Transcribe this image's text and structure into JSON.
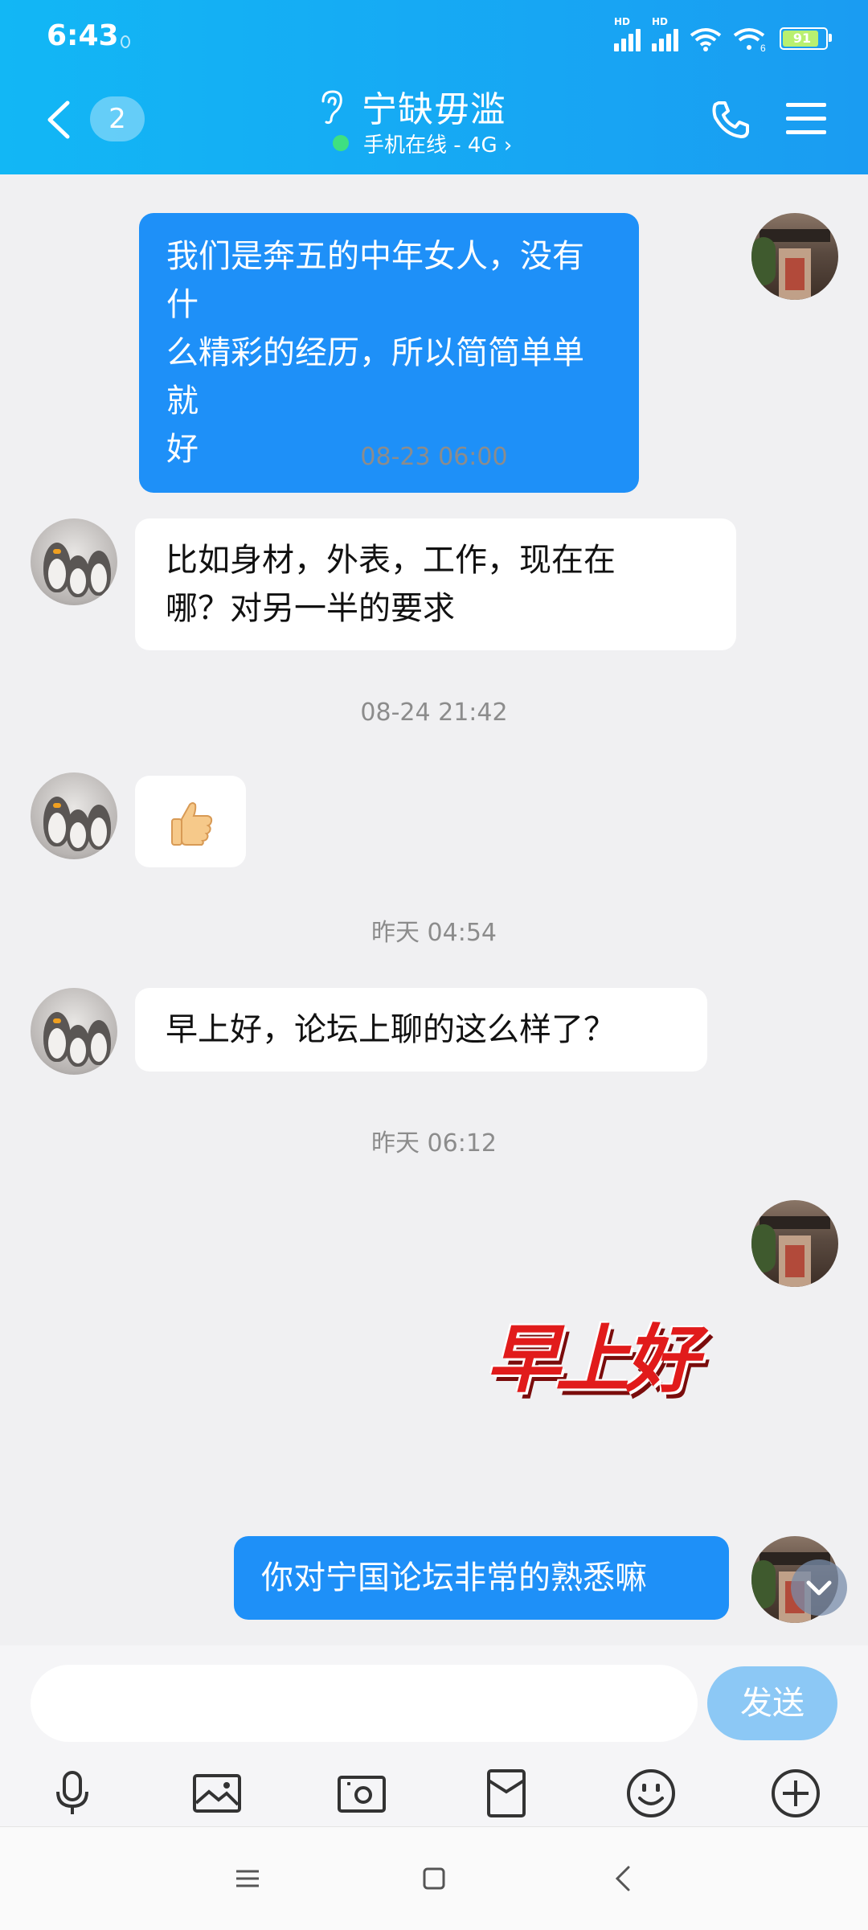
{
  "status_bar": {
    "time": "6:43",
    "battery": "91",
    "hd1": "HD",
    "hd2": "HD"
  },
  "header": {
    "unread_count": "2",
    "title": "宁缺毋滥",
    "subtitle": "手机在线 - 4G ›"
  },
  "messages": [
    {
      "side": "out",
      "text_lines": [
        "我们是奔五的中年女人，没有什",
        "么精彩的经历，所以简简单单就",
        "好"
      ]
    },
    {
      "timestamp": "08-23 06:00"
    },
    {
      "side": "in",
      "text_lines": [
        "比如身材，外表，工作，现在在",
        "哪？对另一半的要求"
      ]
    },
    {
      "timestamp": "08-24 21:42"
    },
    {
      "side": "in",
      "emoji": "👍"
    },
    {
      "timestamp": "昨天 04:54"
    },
    {
      "side": "in",
      "text": "早上好，论坛上聊的这么样了？"
    },
    {
      "timestamp": "昨天 06:12"
    },
    {
      "side": "out",
      "sticker_text": "早上好"
    },
    {
      "side": "out",
      "text": "你对宁国论坛非常的熟悉嘛"
    }
  ],
  "input": {
    "placeholder": "",
    "send_label": "发送"
  },
  "toolbar_icons": [
    "microphone-icon",
    "image-icon",
    "camera-icon",
    "red-packet-icon",
    "emoji-icon",
    "plus-icon"
  ],
  "colors": {
    "header": "#12b7f5",
    "outgoing_bubble": "#1e90f8",
    "incoming_bubble": "#ffffff",
    "send_button": "#8cc8f5"
  }
}
